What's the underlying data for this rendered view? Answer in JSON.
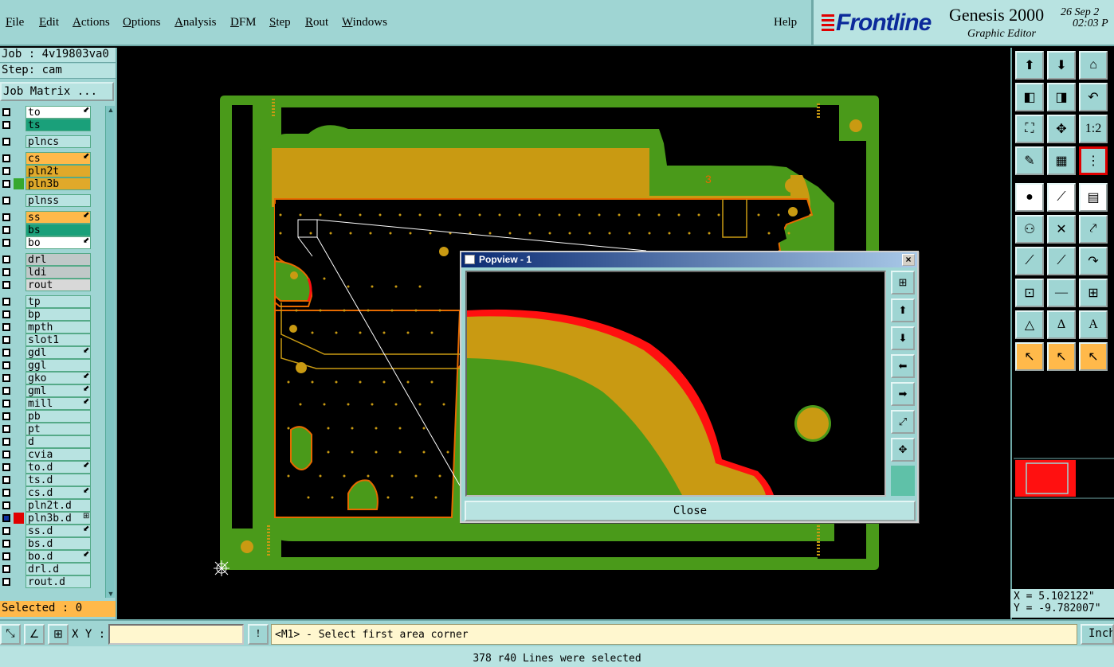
{
  "menubar": {
    "items": [
      {
        "label": "File"
      },
      {
        "label": "Edit"
      },
      {
        "label": "Actions"
      },
      {
        "label": "Options"
      },
      {
        "label": "Analysis"
      },
      {
        "label": "DFM"
      },
      {
        "label": "Step"
      },
      {
        "label": "Rout"
      },
      {
        "label": "Windows"
      }
    ],
    "help": "Help"
  },
  "brand": {
    "logo": "Frontline",
    "product": "Genesis 2000",
    "subtitle": "Graphic Editor",
    "date": "26 Sep 2",
    "time": "02:03 P"
  },
  "job": {
    "job_line": "Job : 4v19803va0",
    "step_line": "Step: cam",
    "matrix_button": "Job Matrix ..."
  },
  "layers": [
    {
      "name": "to",
      "color": "#ffffff",
      "flag": "⬋",
      "gap_before": false
    },
    {
      "name": "ts",
      "color": "#1aa07a",
      "flag": "",
      "gap_before": false
    },
    {
      "name": "plncs",
      "color": "#b8e3e1",
      "flag": "",
      "gap_before": true
    },
    {
      "name": "cs",
      "color": "#ffb94a",
      "flag": "⬋",
      "gap_before": true
    },
    {
      "name": "pln2t",
      "color": "#e0a92a",
      "flag": "",
      "gap_before": false
    },
    {
      "name": "pln3b",
      "color": "#e0a92a",
      "flag": "",
      "swatch": "#36a82e",
      "gap_before": false
    },
    {
      "name": "plnss",
      "color": "#b8e3e1",
      "flag": "",
      "gap_before": true
    },
    {
      "name": "ss",
      "color": "#ffb94a",
      "flag": "⬋",
      "gap_before": true
    },
    {
      "name": "bs",
      "color": "#1aa07a",
      "flag": "",
      "gap_before": false
    },
    {
      "name": "bo",
      "color": "#ffffff",
      "flag": "⬋",
      "gap_before": false
    },
    {
      "name": "drl",
      "color": "#c0c8c8",
      "flag": "",
      "gap_before": true
    },
    {
      "name": "ldi",
      "color": "#c0c8c8",
      "flag": "",
      "gap_before": false
    },
    {
      "name": "rout",
      "color": "#d8d8d8",
      "flag": "",
      "gap_before": false
    },
    {
      "name": "tp",
      "color": "#b8e3e1",
      "flag": "",
      "gap_before": true
    },
    {
      "name": "bp",
      "color": "#b8e3e1",
      "flag": "",
      "gap_before": false
    },
    {
      "name": "mpth",
      "color": "#b8e3e1",
      "flag": "",
      "gap_before": false
    },
    {
      "name": "slot1",
      "color": "#b8e3e1",
      "flag": "",
      "gap_before": false
    },
    {
      "name": "gdl",
      "color": "#b8e3e1",
      "flag": "⬋",
      "gap_before": false
    },
    {
      "name": "ggl",
      "color": "#b8e3e1",
      "flag": "",
      "gap_before": false
    },
    {
      "name": "gko",
      "color": "#b8e3e1",
      "flag": "⬋",
      "gap_before": false
    },
    {
      "name": "gml",
      "color": "#b8e3e1",
      "flag": "⬋",
      "gap_before": false
    },
    {
      "name": "mill",
      "color": "#b8e3e1",
      "flag": "⬋",
      "gap_before": false
    },
    {
      "name": "pb",
      "color": "#b8e3e1",
      "flag": "",
      "gap_before": false
    },
    {
      "name": "pt",
      "color": "#b8e3e1",
      "flag": "",
      "gap_before": false
    },
    {
      "name": "d",
      "color": "#b8e3e1",
      "flag": "",
      "gap_before": false
    },
    {
      "name": "cvia",
      "color": "#b8e3e1",
      "flag": "",
      "gap_before": false
    },
    {
      "name": "to.d",
      "color": "#b8e3e1",
      "flag": "⬋",
      "gap_before": false
    },
    {
      "name": "ts.d",
      "color": "#b8e3e1",
      "flag": "",
      "gap_before": false
    },
    {
      "name": "cs.d",
      "color": "#b8e3e1",
      "flag": "⬋",
      "gap_before": false
    },
    {
      "name": "pln2t.d",
      "color": "#b8e3e1",
      "flag": "",
      "gap_before": false
    },
    {
      "name": "pln3b.d",
      "color": "#b8e3e1",
      "flag": "⊞",
      "swatch": "#e00000",
      "cb": "#1030a0",
      "gap_before": false
    },
    {
      "name": "ss.d",
      "color": "#b8e3e1",
      "flag": "⬋",
      "gap_before": false
    },
    {
      "name": "bs.d",
      "color": "#b8e3e1",
      "flag": "",
      "gap_before": false
    },
    {
      "name": "bo.d",
      "color": "#b8e3e1",
      "flag": "⬋",
      "gap_before": false
    },
    {
      "name": "drl.d",
      "color": "#b8e3e1",
      "flag": "",
      "gap_before": false
    },
    {
      "name": "rout.d",
      "color": "#b8e3e1",
      "flag": "",
      "gap_before": false
    }
  ],
  "selected": "Selected : 0",
  "board_label": "3",
  "popview": {
    "title": "Popview - 1",
    "close_x": "×",
    "close_button": "Close"
  },
  "coords": {
    "x": "X = 5.102122\"",
    "y": "Y = -9.782007\""
  },
  "bottombar": {
    "xy_label": "X Y :",
    "xy_value": "",
    "prompt_icon": "!",
    "prompt": "<M1> - Select first area corner",
    "units": "Inch"
  },
  "status": "378 r40 Lines were selected",
  "colors": {
    "panel": "#9fd5d3",
    "board_green": "#4a9a1a",
    "copper": "#c99a12",
    "outline_orange": "#e66a00",
    "highlight_red": "#ff1010",
    "selected_orange": "#ffb94a"
  },
  "icons": {
    "toolbar": [
      "zoom-in-icon",
      "zoom-out-icon",
      "home-icon",
      "pan-left-icon",
      "pan-right-icon",
      "undo-view-icon",
      "fit-icon",
      "center-icon",
      "one-to-one-icon",
      "measure-icon",
      "grid-icon",
      "layers-icon",
      "select-icon",
      "net-icon",
      "ruler-icon",
      "connect-icon",
      "cross-icon",
      "route-icon",
      "line-icon",
      "slash-icon",
      "arc-icon",
      "pad-icon",
      "dash-icon",
      "snap-icon",
      "triangle-icon",
      "triangle-a-icon",
      "triangle-b-icon",
      "pointer-icon",
      "pointer-frame-icon",
      "pointer-alt-icon"
    ]
  }
}
